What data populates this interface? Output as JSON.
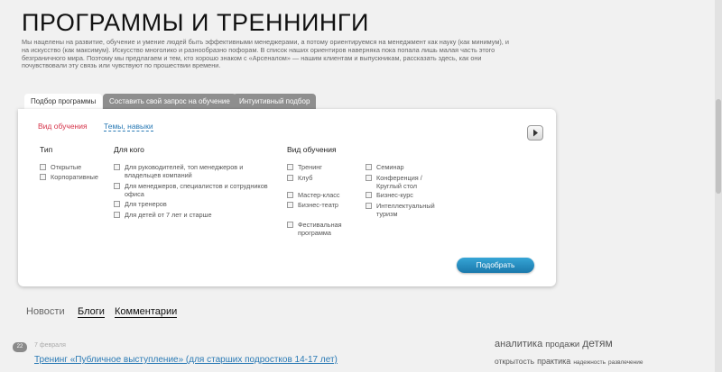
{
  "title": "ПРОГРАММЫ И ТРЕННИНГИ",
  "intro": "Мы нацелены на развитие, обучение и умение людей быть эффективными менеджерами, а потому ориентируемся на менеджмент как науку (как минимум), и на искусство (как максимум). Искусство многолико и разнообразно пофорам. В список наших ориентиров наверняка пока попала лишь малая часть этого безграничного мира. Поэтому мы предлагаем и тем, кто хорошо знаком с «Арсеналом» — нашим клиентам и выпускникам, рассказать здесь, как они почувствовали эту связь или чувствуют по прошествии времени.",
  "tabs": [
    "Подбор программы",
    "Составить свой запрос на обучение",
    "Интуитивный подбор"
  ],
  "subtabs": {
    "active": "Вид обучения",
    "link": "Темы, навыки"
  },
  "filters": {
    "type": {
      "heading": "Тип",
      "options": [
        "Открытые",
        "Корпоративные"
      ]
    },
    "audience": {
      "heading": "Для кого",
      "options": [
        "Для руководителей, топ менеджеров и владельцев компаний",
        "Для менеджеров, специалистов и сотрудников офиса",
        "Для тренеров",
        "Для детей от 7 лет и старше"
      ]
    },
    "kind": {
      "heading": "Вид обучения",
      "left": [
        "Тренинг",
        "Клуб",
        "Мастер-класс",
        "Бизнес-театр",
        "Фестивальная программа"
      ],
      "right": [
        "Семинар",
        "Конференция / Круглый стол",
        "Бизнес-курс",
        "Интеллектуальный туризм"
      ]
    }
  },
  "submit_label": "Подобрать",
  "news_tabs": [
    "Новости",
    "Блоги",
    "Комментарии"
  ],
  "news": {
    "comments": "22",
    "date": "7 февраля",
    "title": "Тренинг «Публичное выступление» (для старших подростков 14-17 лет)"
  },
  "tags": {
    "line1": [
      {
        "text": "аналитика",
        "size": "11px"
      },
      {
        "text": "продажи",
        "size": "9.5px"
      },
      {
        "text": "детям",
        "size": "12px"
      }
    ],
    "line2": [
      {
        "text": "открытость",
        "size": "8.5px"
      },
      {
        "text": "практика",
        "size": "9px"
      },
      {
        "text": "надежность",
        "size": "6.5px"
      },
      {
        "text": "развлечение",
        "size": "6.5px"
      }
    ]
  },
  "colors": {
    "accent": "#d6354b",
    "link": "#2a7ab5",
    "button": "#1a78ab"
  }
}
